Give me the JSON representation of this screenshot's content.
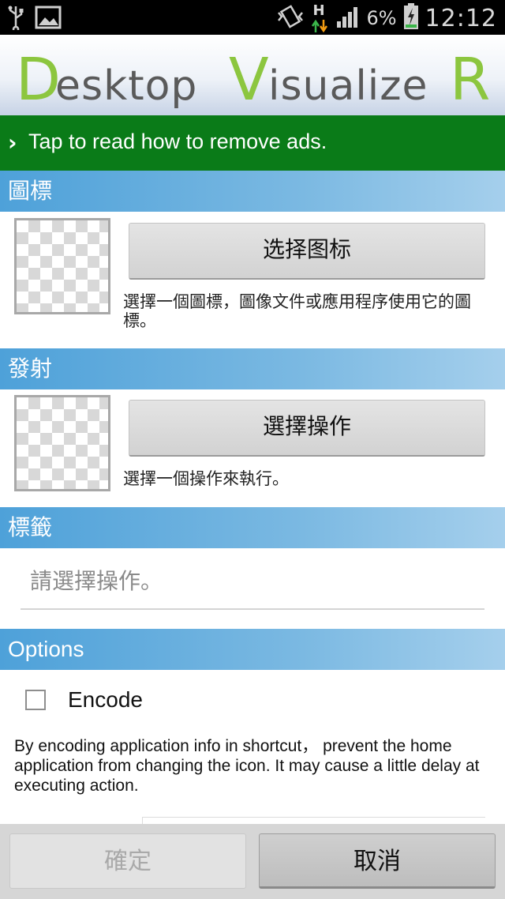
{
  "status_bar": {
    "battery_percent": "6%",
    "network_type": "H",
    "time": "12:12",
    "icons": [
      "usb-icon",
      "image-icon",
      "vibrate-icon",
      "data-arrows-icon",
      "signal-icon",
      "battery-charging-icon"
    ]
  },
  "app": {
    "logo_text": "DesktopVisualizeR"
  },
  "ad_bar": {
    "text": "Tap to read how to remove ads."
  },
  "icon_section": {
    "header": "圖標",
    "button_label": "选择图标",
    "description": "選擇一個圖標，圖像文件或應用程序使用它的圖標。"
  },
  "launch_section": {
    "header": "發射",
    "button_label": "選擇操作",
    "description": "選擇一個操作來執行。"
  },
  "label_section": {
    "header": "標籤",
    "input_placeholder": "請選擇操作。"
  },
  "options_section": {
    "header": "Options",
    "encode_label": "Encode",
    "encode_checked": false,
    "description": "By encoding application info in shortcut， prevent the home application from changing the icon. It may cause a little delay at executing action."
  },
  "bottom_bar": {
    "ok_label": "確定",
    "cancel_label": "取消"
  },
  "colors": {
    "ad_green": "#0a7b18",
    "section_blue": "#4ea1d9",
    "logo_green": "#8cc63f",
    "logo_gray": "#5a5a5a"
  }
}
